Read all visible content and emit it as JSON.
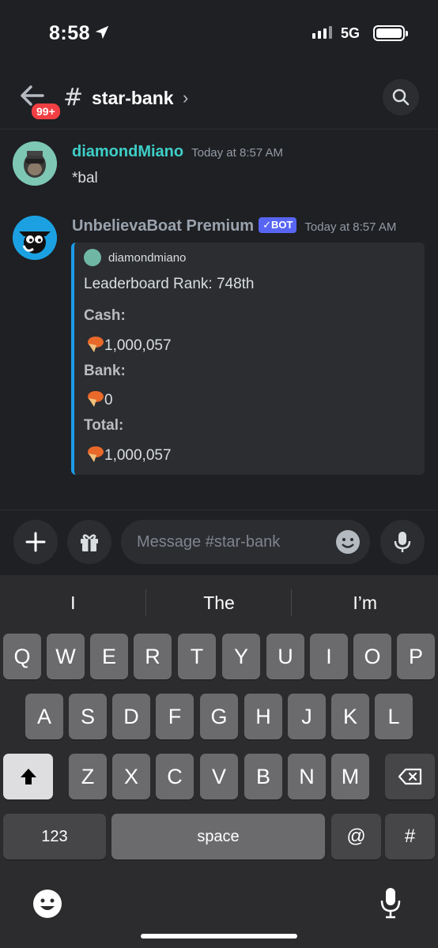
{
  "status_bar": {
    "time": "8:58",
    "network": "5G"
  },
  "header": {
    "badge": "99+",
    "hash": "#",
    "channel": "star-bank",
    "chevron": "›"
  },
  "messages": [
    {
      "author": "diamondMiano",
      "author_color": "#3ecfc8",
      "timestamp": "Today at 8:57 AM",
      "text": "*bal"
    },
    {
      "author": "UnbelievaBoat Premium",
      "author_color": "#9aa3ad",
      "bot_tag": "✓BOT",
      "timestamp": "Today at 8:57 AM"
    }
  ],
  "embed": {
    "author": "diamondmiano",
    "rank": "Leaderboard Rank: 748th",
    "cash_label": "Cash:",
    "cash_value": "1,000,057",
    "bank_label": "Bank:",
    "bank_value": "0",
    "total_label": "Total:",
    "total_value": "1,000,057",
    "accent_color": "#1e9be9"
  },
  "input": {
    "placeholder": "Message #star-bank"
  },
  "keyboard": {
    "suggestions": [
      "I",
      "The",
      "I’m"
    ],
    "row1": [
      "Q",
      "W",
      "E",
      "R",
      "T",
      "Y",
      "U",
      "I",
      "O",
      "P"
    ],
    "row2": [
      "A",
      "S",
      "D",
      "F",
      "G",
      "H",
      "J",
      "K",
      "L"
    ],
    "row3": [
      "Z",
      "X",
      "C",
      "V",
      "B",
      "N",
      "M"
    ],
    "numbers": "123",
    "space": "space",
    "at": "@",
    "hash": "#"
  }
}
